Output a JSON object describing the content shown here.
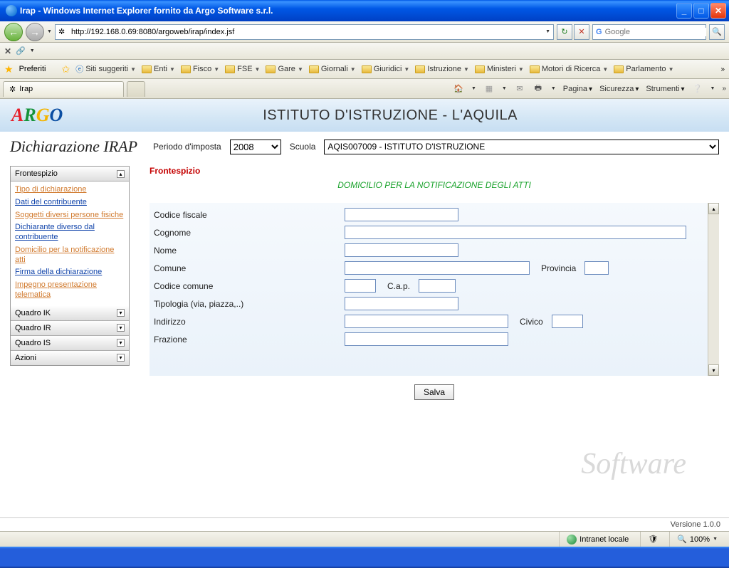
{
  "window": {
    "title": "Irap - Windows Internet Explorer fornito da Argo Software s.r.l."
  },
  "nav": {
    "url": "http://192.168.0.69:8080/argoweb/irap/index.jsf",
    "search_placeholder": "Google"
  },
  "favbar": {
    "preferiti": "Preferiti",
    "siti": "Siti suggeriti",
    "folders": [
      "Enti",
      "Fisco",
      "FSE",
      "Gare",
      "Giornali",
      "Giuridici",
      "Istruzione",
      "Ministeri",
      "Motori di Ricerca",
      "Parlamento"
    ]
  },
  "tabs": {
    "tab1": "Irap",
    "right": {
      "pagina": "Pagina",
      "sicurezza": "Sicurezza",
      "strumenti": "Strumenti"
    }
  },
  "page": {
    "istituto": "ISTITUTO D'ISTRUZIONE - L'AQUILA",
    "dich": "Dichiarazione IRAP",
    "periodo_label": "Periodo d'imposta",
    "periodo_value": "2008",
    "scuola_label": "Scuola",
    "scuola_value": "AQIS007009 - ISTITUTO D'ISTRUZIONE"
  },
  "accordion": {
    "h1": "Frontespizio",
    "links": [
      {
        "t": "Tipo di dichiarazione",
        "c": "orange"
      },
      {
        "t": "Dati del contribuente",
        "c": "blue"
      },
      {
        "t": "Soggetti diversi persone fisiche",
        "c": "orange"
      },
      {
        "t": "Dichiarante diverso dal contribuente",
        "c": "blue"
      },
      {
        "t": "Domicilio per la notificazione atti",
        "c": "orange"
      },
      {
        "t": "Firma della dichiarazione",
        "c": "blue"
      },
      {
        "t": "Impegno presentazione telematica",
        "c": "orange"
      }
    ],
    "h2": "Quadro IK",
    "h3": "Quadro IR",
    "h4": "Quadro IS",
    "h5": "Azioni"
  },
  "form": {
    "title": "Frontespizio",
    "subtitle": "DOMICILIO PER LA NOTIFICAZIONE DEGLI ATTI",
    "labels": {
      "cf": "Codice fiscale",
      "cognome": "Cognome",
      "nome": "Nome",
      "comune": "Comune",
      "provincia": "Provincia",
      "codcomune": "Codice comune",
      "cap": "C.a.p.",
      "tipologia": "Tipologia (via, piazza,..)",
      "indirizzo": "Indirizzo",
      "civico": "Civico",
      "frazione": "Frazione"
    },
    "save": "Salva"
  },
  "footer": {
    "version": "Versione 1.0.0"
  },
  "status": {
    "zone": "Intranet locale",
    "zoom": "100%"
  }
}
